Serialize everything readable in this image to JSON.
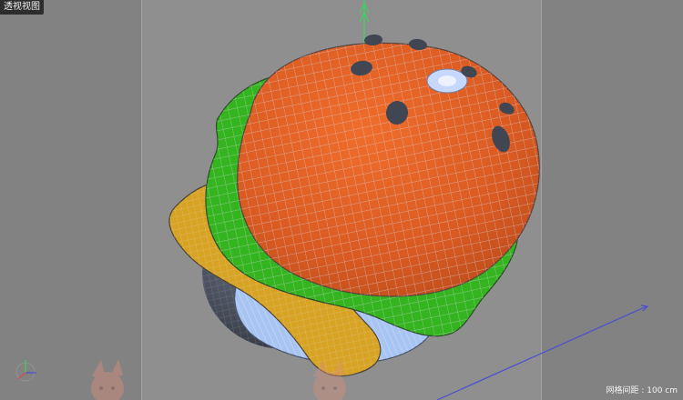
{
  "viewport": {
    "title": "透视视图",
    "grid_spacing_label": "网格间距 : 100 cm"
  },
  "colors": {
    "background": "#8f8f8f",
    "bun": "#d95a22",
    "lettuce": "#34b51f",
    "cheese": "#d8a322",
    "patty": "#4a4f5a",
    "wire": "#bfc8d8",
    "axis_y": "#39d65f",
    "axis_x": "#4b4ed1",
    "axis_z": "#d84b4b"
  },
  "icons": {
    "axis_gizmo": "axis-gizmo-icon",
    "character_sticker": "character-sticker-icon"
  }
}
